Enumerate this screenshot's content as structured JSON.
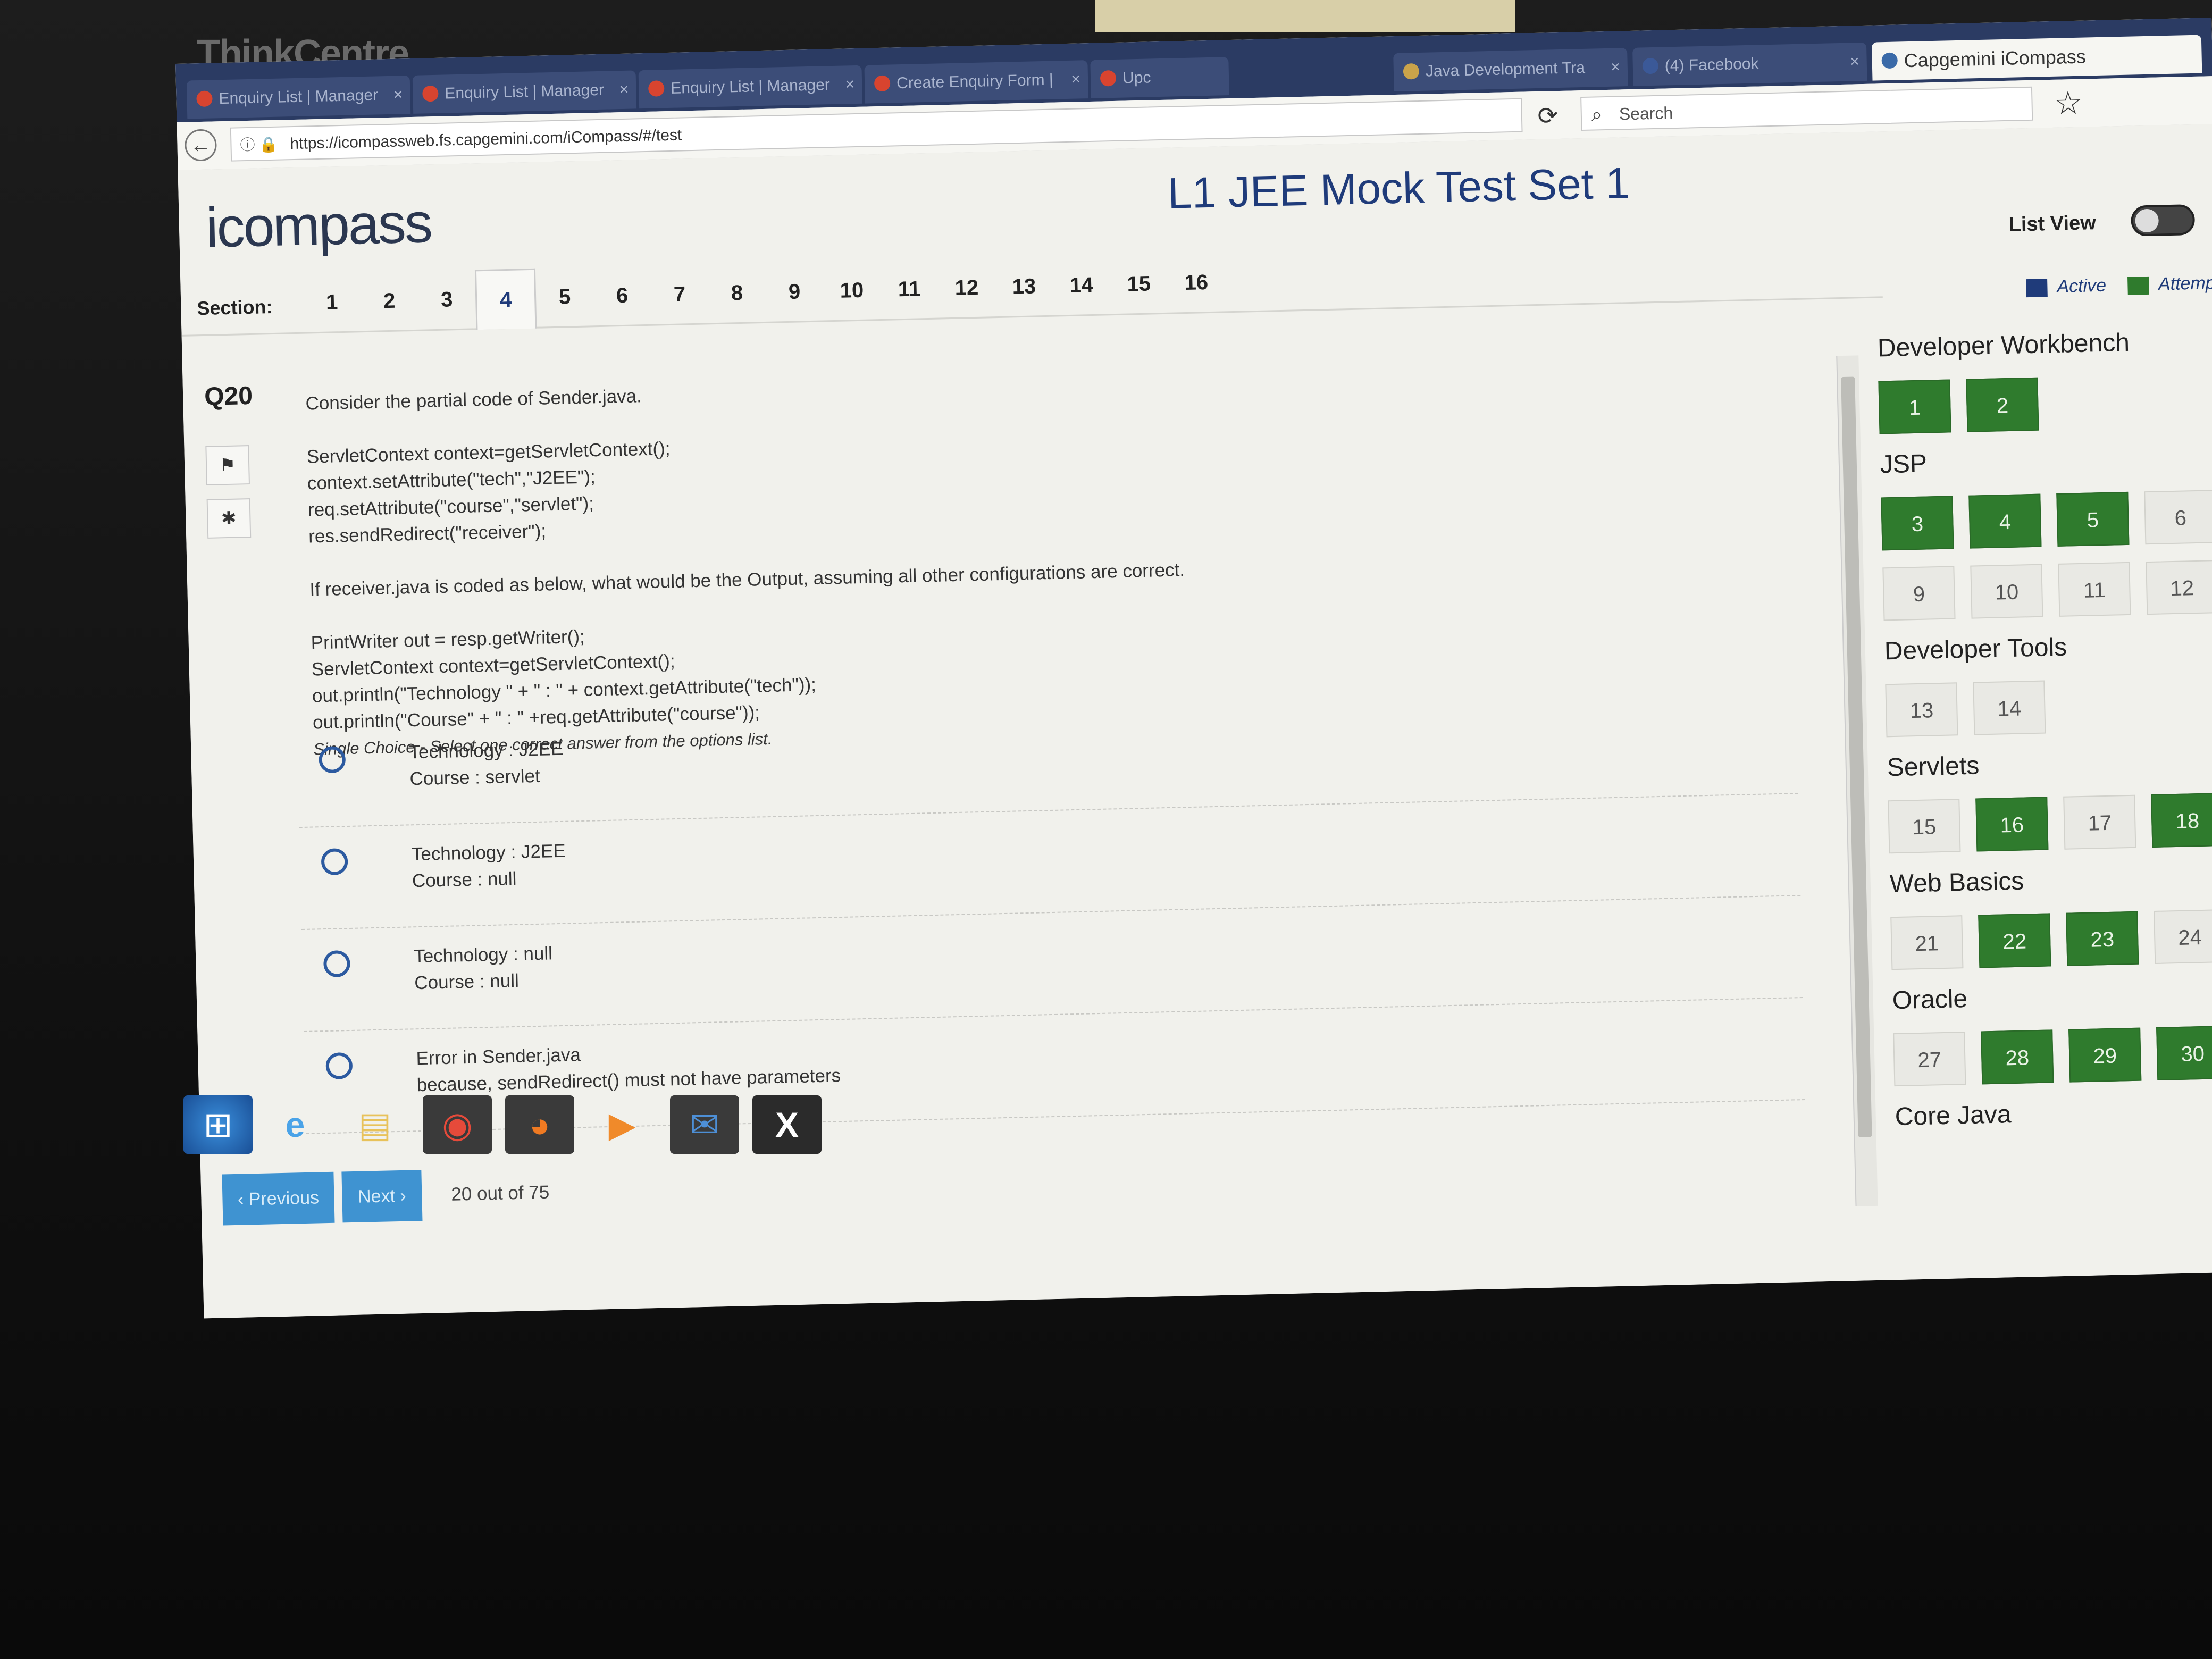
{
  "monitor_brand": "ThinkCentre",
  "browser": {
    "tabs": [
      {
        "label": "Enquiry List | Manager"
      },
      {
        "label": "Enquiry List | Manager"
      },
      {
        "label": "Enquiry List | Manager"
      },
      {
        "label": "Create Enquiry Form |"
      },
      {
        "label": "Upc"
      },
      {
        "label": "Java Development Tra"
      },
      {
        "label": "(4) Facebook"
      },
      {
        "label": "Capgemini iCompass"
      }
    ],
    "url": "https://icompassweb.fs.capgemini.com/iCompass/#/test",
    "search_placeholder": "Search"
  },
  "app": {
    "logo": "icompass",
    "title": "L1 JEE Mock Test Set 1",
    "list_view_label": "List View",
    "section_label": "Section:",
    "sections": [
      "1",
      "2",
      "3",
      "4",
      "5",
      "6",
      "7",
      "8",
      "9",
      "10",
      "11",
      "12",
      "13",
      "14",
      "15",
      "16"
    ],
    "active_section": "4",
    "legend": {
      "active": "Active",
      "attempted": "Attemp"
    },
    "colors": {
      "primary": "#1f3b7a",
      "attempted": "#2f7b2d",
      "button": "#3f93d1"
    }
  },
  "question": {
    "number": "Q20",
    "intro": "Consider the partial code of Sender.java.",
    "code1": [
      "ServletContext context=getServletContext();",
      "context.setAttribute(\"tech\",\"J2EE\");",
      "req.setAttribute(\"course\",\"servlet\");",
      "res.sendRedirect(\"receiver\");"
    ],
    "prompt": "If receiver.java is coded as below, what would be the Output, assuming all other configurations are correct.",
    "code2": [
      "PrintWriter out = resp.getWriter();",
      "ServletContext context=getServletContext();",
      "out.println(\"Technology \" + \" : \" + context.getAttribute(\"tech\"));",
      "out.println(\"Course\" + \" : \" +req.getAttribute(\"course\"));"
    ],
    "hint": "Single Choice - Select one correct answer from the options list.",
    "options": [
      {
        "line1": "Technology : J2EE",
        "line2": "Course : servlet"
      },
      {
        "line1": "Technology : J2EE",
        "line2": "Course : null"
      },
      {
        "line1": "Technology : null",
        "line2": "Course : null"
      },
      {
        "line1": "Error in Sender.java",
        "line2": "because, sendRedirect() must not have parameters"
      }
    ]
  },
  "footer": {
    "previous": "‹ Previous",
    "next": "Next ›",
    "progress": "20 out of 75"
  },
  "palette": [
    {
      "title": "Developer Workbench",
      "items": [
        {
          "n": "1",
          "a": true
        },
        {
          "n": "2",
          "a": true
        }
      ]
    },
    {
      "title": "JSP",
      "items": [
        {
          "n": "3",
          "a": true
        },
        {
          "n": "4",
          "a": true
        },
        {
          "n": "5",
          "a": true
        },
        {
          "n": "6",
          "a": false
        },
        {
          "n": "9",
          "a": false
        },
        {
          "n": "10",
          "a": false
        },
        {
          "n": "11",
          "a": false
        },
        {
          "n": "12",
          "a": false
        }
      ]
    },
    {
      "title": "Developer Tools",
      "items": [
        {
          "n": "13",
          "a": false
        },
        {
          "n": "14",
          "a": false
        }
      ]
    },
    {
      "title": "Servlets",
      "items": [
        {
          "n": "15",
          "a": false
        },
        {
          "n": "16",
          "a": true
        },
        {
          "n": "17",
          "a": false
        },
        {
          "n": "18",
          "a": true
        }
      ]
    },
    {
      "title": "Web Basics",
      "items": [
        {
          "n": "21",
          "a": false
        },
        {
          "n": "22",
          "a": true
        },
        {
          "n": "23",
          "a": true
        },
        {
          "n": "24",
          "a": false
        }
      ]
    },
    {
      "title": "Oracle",
      "items": [
        {
          "n": "27",
          "a": false
        },
        {
          "n": "28",
          "a": true
        },
        {
          "n": "29",
          "a": true
        },
        {
          "n": "30",
          "a": true
        }
      ]
    },
    {
      "title": "Core Java",
      "items": []
    }
  ],
  "taskbar": [
    {
      "icon": "windows-start-icon"
    },
    {
      "icon": "internet-explorer-icon"
    },
    {
      "icon": "file-explorer-icon"
    },
    {
      "icon": "chrome-icon"
    },
    {
      "icon": "firefox-icon"
    },
    {
      "icon": "media-player-icon"
    },
    {
      "icon": "outlook-icon"
    },
    {
      "icon": "excel-icon"
    }
  ]
}
